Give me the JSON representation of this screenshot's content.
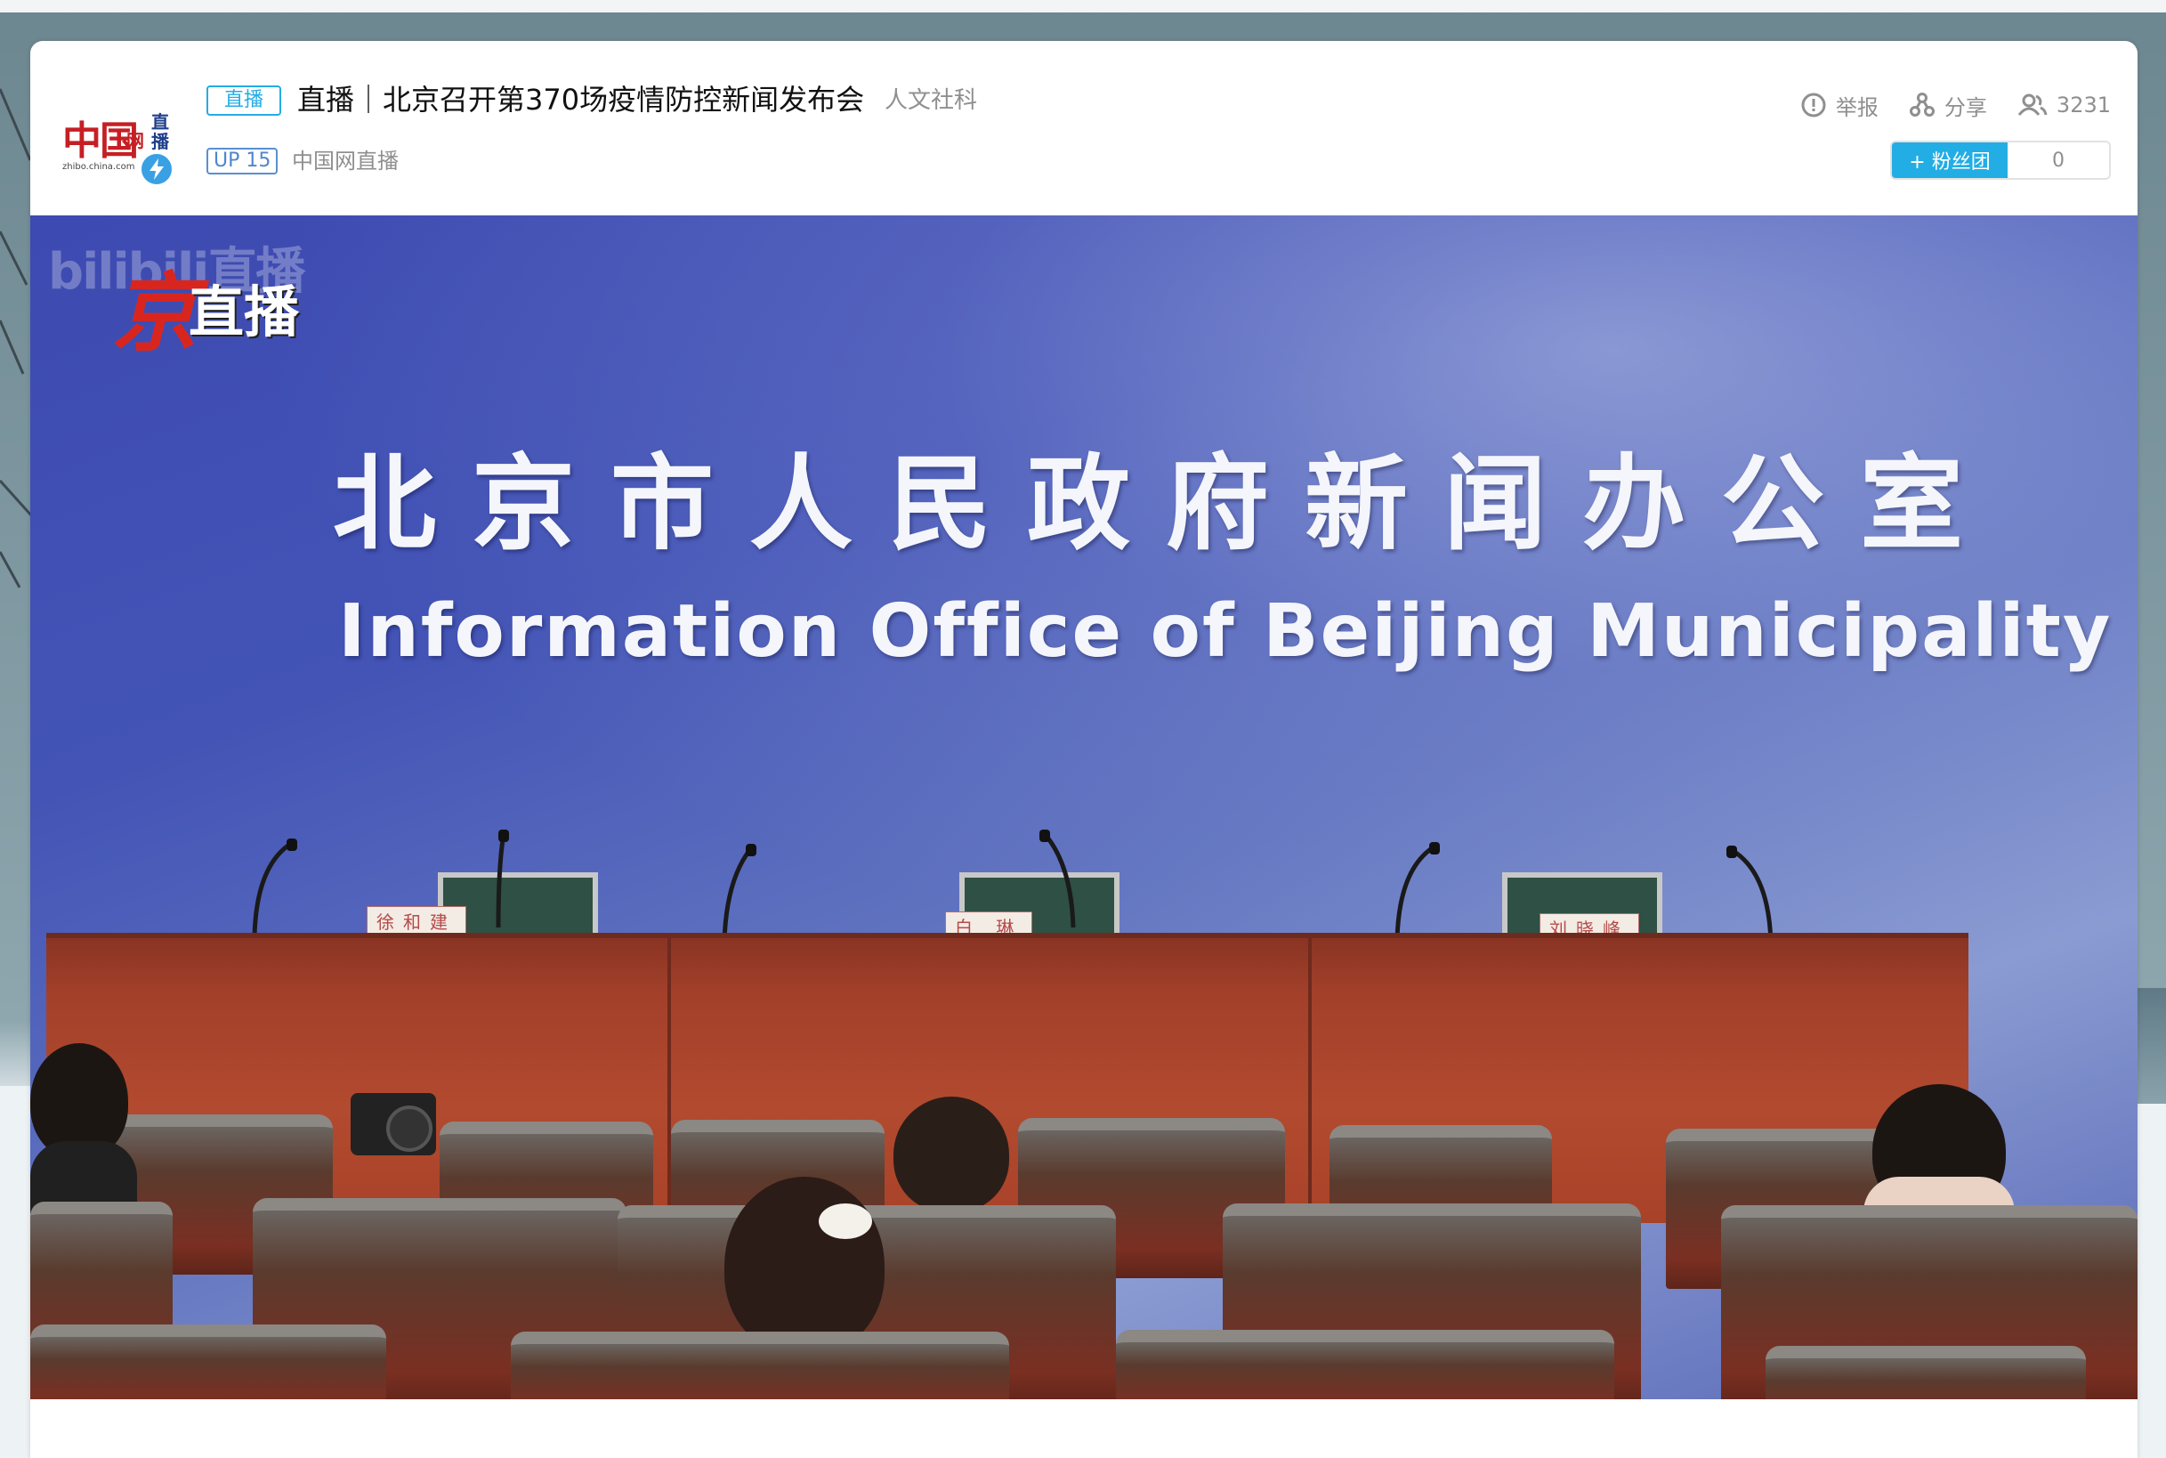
{
  "header": {
    "live_tag": "直播",
    "title": "直播｜北京召开第370场疫情防控新闻发布会",
    "category": "人文社科",
    "up_level": "UP 15",
    "streamer": "中国网直播",
    "logo": {
      "main": "中国",
      "net": "网",
      "live": "直播",
      "url": "zhibo.china.com"
    },
    "actions": {
      "report": "举报",
      "share": "分享",
      "viewers": "3231"
    },
    "fan_club_button": "+ 粉丝团",
    "fan_club_count": "0"
  },
  "video": {
    "watermark": "bilibili直播",
    "jing_char": "京",
    "jing_text": "直播",
    "backdrop_cn": "北京市人民政府新闻办公室",
    "backdrop_en": "Information Office of Beijing Municipality",
    "name_plates": [
      "徐和建",
      "白 琳",
      "刘晓峰"
    ]
  },
  "colors": {
    "accent": "#23ade5",
    "brand_red": "#c51f24",
    "backdrop_blue": "#4354b6",
    "desk": "#a3402a"
  }
}
